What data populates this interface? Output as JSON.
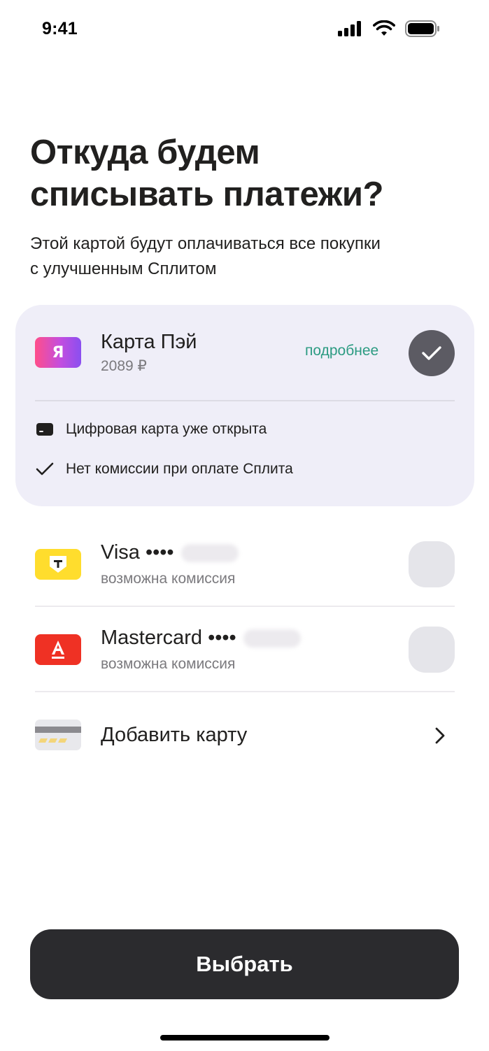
{
  "status_bar": {
    "time": "9:41",
    "icons": [
      "cellular-icon",
      "wifi-icon",
      "battery-icon"
    ]
  },
  "header": {
    "title_line1": "Откуда будем",
    "title_line2": "списывать платежи?",
    "subtitle_line1": "Этой картой будут оплачиваться все покупки",
    "subtitle_line2": "с улучшенным Сплитом"
  },
  "selected_card": {
    "logo_letter": "Я",
    "name": "Карта Пэй",
    "balance": "2089 ₽",
    "more_link": "подробнее",
    "selected": true,
    "features": [
      {
        "icon": "card-icon",
        "text": "Цифровая карта уже открыта"
      },
      {
        "icon": "check-icon",
        "text": "Нет комиссии при оплате Сплита"
      }
    ]
  },
  "cards": [
    {
      "logo_letter": "T",
      "logo_color": "#ffdd2d",
      "name": "Visa ••••",
      "note": "возможна комиссия",
      "selected": false
    },
    {
      "logo_letter": "А",
      "logo_color": "#ef3124",
      "name": "Mastercard ••••",
      "note": "возможна комиссия",
      "selected": false
    }
  ],
  "add_card": {
    "label": "Добавить карту"
  },
  "action": {
    "label": "Выбрать"
  },
  "colors": {
    "accent_link": "#2c9b82",
    "selected_bg": "#efeef8",
    "button_bg": "#2b2b2e"
  }
}
